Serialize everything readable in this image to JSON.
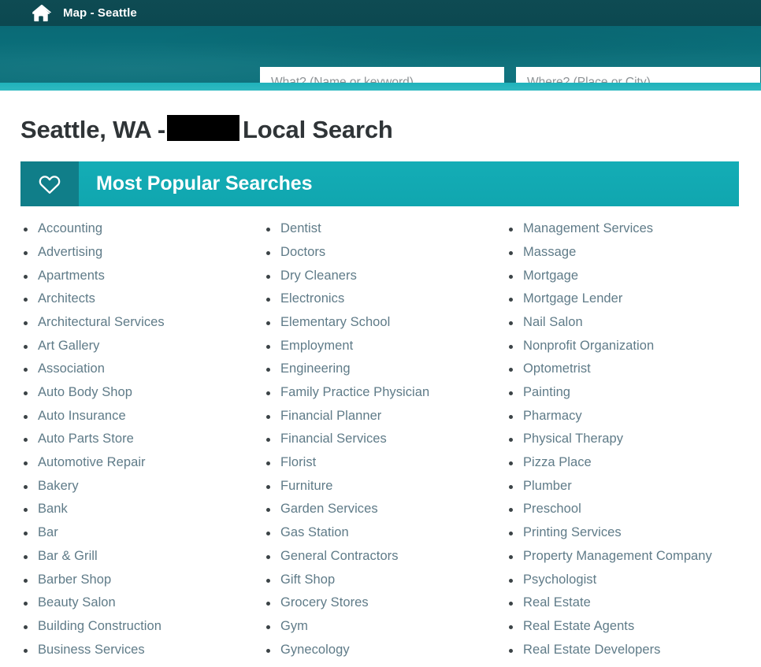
{
  "topbar": {
    "home_icon": "home-icon",
    "title": "Map - Seattle"
  },
  "search": {
    "what_placeholder": "What? (Name or keyword)",
    "what_value": "",
    "where_placeholder": "Where? (Place or City)",
    "where_value": ""
  },
  "page": {
    "title_prefix": "Seattle, WA - ",
    "title_suffix": "Local Search",
    "redacted": true
  },
  "section": {
    "icon": "heart-icon",
    "title": "Most Popular Searches"
  },
  "colors": {
    "topbar": "#0d4a52",
    "search_band": "#0b6d78",
    "accent_strip": "#18b0b9",
    "banner": "#13aab3",
    "banner_icon_box": "#107e89",
    "link_text": "#5f7b88",
    "title_text": "#2f3437",
    "redaction": "#000000"
  },
  "columns": [
    {
      "items": [
        "Accounting",
        "Advertising",
        "Apartments",
        "Architects",
        "Architectural Services",
        "Art Gallery",
        "Association",
        "Auto Body Shop",
        "Auto Insurance",
        "Auto Parts Store",
        "Automotive Repair",
        "Bakery",
        "Bank",
        "Bar",
        "Bar & Grill",
        "Barber Shop",
        "Beauty Salon",
        "Building Construction",
        "Business Services"
      ]
    },
    {
      "items": [
        "Dentist",
        "Doctors",
        "Dry Cleaners",
        "Electronics",
        "Elementary School",
        "Employment",
        "Engineering",
        "Family Practice Physician",
        "Financial Planner",
        "Financial Services",
        "Florist",
        "Furniture",
        "Garden Services",
        "Gas Station",
        "General Contractors",
        "Gift Shop",
        "Grocery Stores",
        "Gym",
        "Gynecology"
      ]
    },
    {
      "items": [
        "Management Services",
        "Massage",
        "Mortgage",
        "Mortgage Lender",
        "Nail Salon",
        "Nonprofit Organization",
        "Optometrist",
        "Painting",
        "Pharmacy",
        "Physical Therapy",
        "Pizza Place",
        "Plumber",
        "Preschool",
        "Printing Services",
        "Property Management Company",
        "Psychologist",
        "Real Estate",
        "Real Estate Agents",
        "Real Estate Developers"
      ]
    }
  ]
}
